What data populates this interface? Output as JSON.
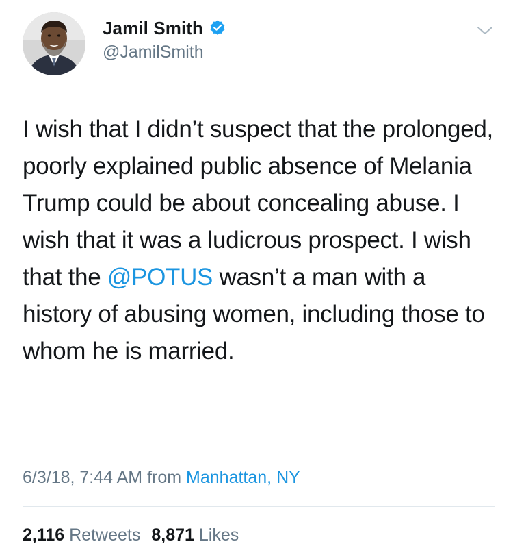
{
  "author": {
    "display_name": "Jamil Smith",
    "handle": "@JamilSmith",
    "verified": true,
    "avatar_icon": "profile-photo"
  },
  "tweet": {
    "text_before_mention": "I wish that I didn’t suspect that the prolonged, poorly explained public absence of Melania Trump could be about concealing abuse. I wish that it was a ludicrous prospect. I wish that the ",
    "mention": "@POTUS",
    "text_after_mention": " wasn’t a man with a history of abusing women, including those to whom he is married."
  },
  "meta": {
    "timestamp": "6/3/18, 7:44 AM",
    "from_label": "from",
    "location": "Manhattan, NY"
  },
  "stats": {
    "retweets_count": "2,116",
    "retweets_label": "Retweets",
    "likes_count": "8,871",
    "likes_label": "Likes"
  },
  "colors": {
    "link": "#1b95e0",
    "secondary_text": "#657786",
    "primary_text": "#14171a",
    "verified_badge": "#1da1f2"
  },
  "icons": {
    "verified": "verified-badge-icon",
    "menu": "chevron-down-icon"
  }
}
